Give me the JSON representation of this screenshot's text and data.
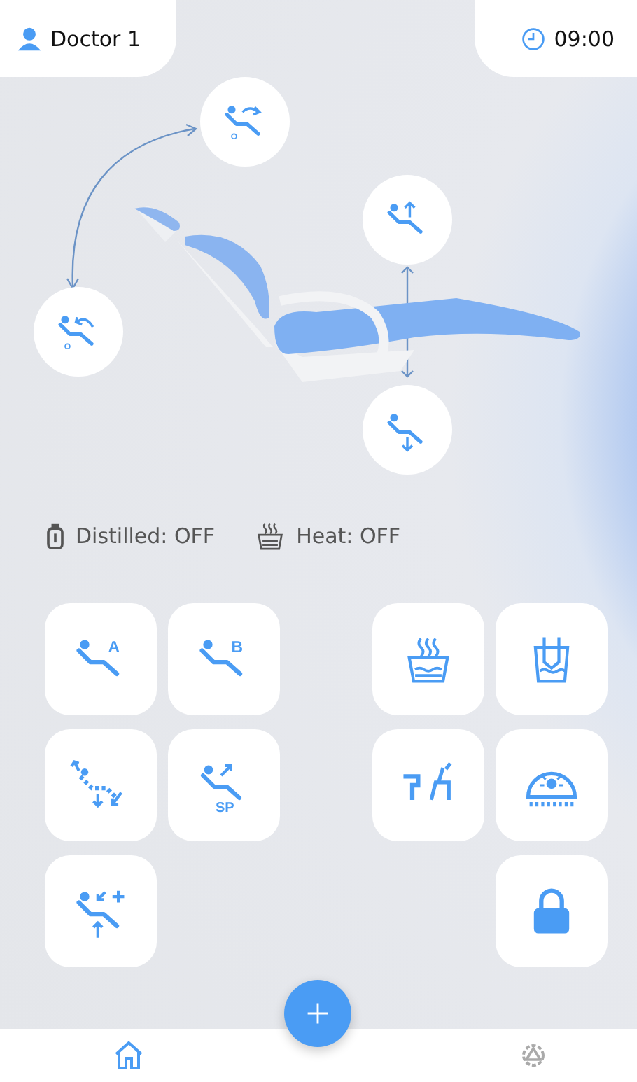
{
  "header": {
    "user": "Doctor 1",
    "time": "09:00"
  },
  "status": [
    {
      "kind": "distilled",
      "label": "Distilled: OFF"
    },
    {
      "kind": "heat",
      "label": "Heat: OFF"
    }
  ],
  "left_controls": [
    {
      "kind": "preset",
      "label": "A"
    },
    {
      "kind": "preset",
      "label": "B"
    },
    {
      "kind": "return"
    },
    {
      "kind": "preset-arrow",
      "label": "SP"
    },
    {
      "kind": "memory"
    }
  ],
  "right_controls": [
    {
      "kind": "heater"
    },
    {
      "kind": "cup-fill"
    },
    {
      "kind": "rinse"
    },
    {
      "kind": "light"
    },
    {
      "kind": "lock"
    }
  ],
  "nav": [
    {
      "kind": "home",
      "selected": true
    },
    {
      "kind": "settings",
      "selected": false
    }
  ]
}
